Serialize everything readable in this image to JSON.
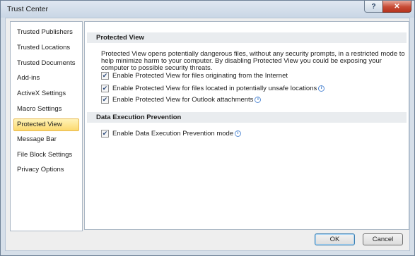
{
  "window": {
    "title": "Trust Center",
    "help_label": "?",
    "close_label": "✕"
  },
  "sidebar": {
    "items": [
      {
        "label": "Trusted Publishers"
      },
      {
        "label": "Trusted Locations"
      },
      {
        "label": "Trusted Documents"
      },
      {
        "label": "Add-ins"
      },
      {
        "label": "ActiveX Settings"
      },
      {
        "label": "Macro Settings"
      },
      {
        "label": "Protected View"
      },
      {
        "label": "Message Bar"
      },
      {
        "label": "File Block Settings"
      },
      {
        "label": "Privacy Options"
      }
    ],
    "selected": "Protected View"
  },
  "protected_view": {
    "heading": "Protected View",
    "description": "Protected View opens potentially dangerous files, without any security prompts, in a restricted mode to help minimize harm to your computer. By disabling Protected View you could be exposing your computer to possible security threats.",
    "options": [
      {
        "label": "Enable Protected View for files originating from the Internet",
        "checked": true
      },
      {
        "label": "Enable Protected View for files located in potentially unsafe locations",
        "checked": true
      },
      {
        "label": "Enable Protected View for Outlook attachments",
        "checked": true
      }
    ]
  },
  "dep": {
    "heading": "Data Execution Prevention",
    "options": [
      {
        "label": "Enable Data Execution Prevention mode",
        "checked": true
      }
    ]
  },
  "buttons": {
    "ok": "OK",
    "cancel": "Cancel"
  },
  "glyphs": {
    "check": "✔",
    "info": "i"
  }
}
